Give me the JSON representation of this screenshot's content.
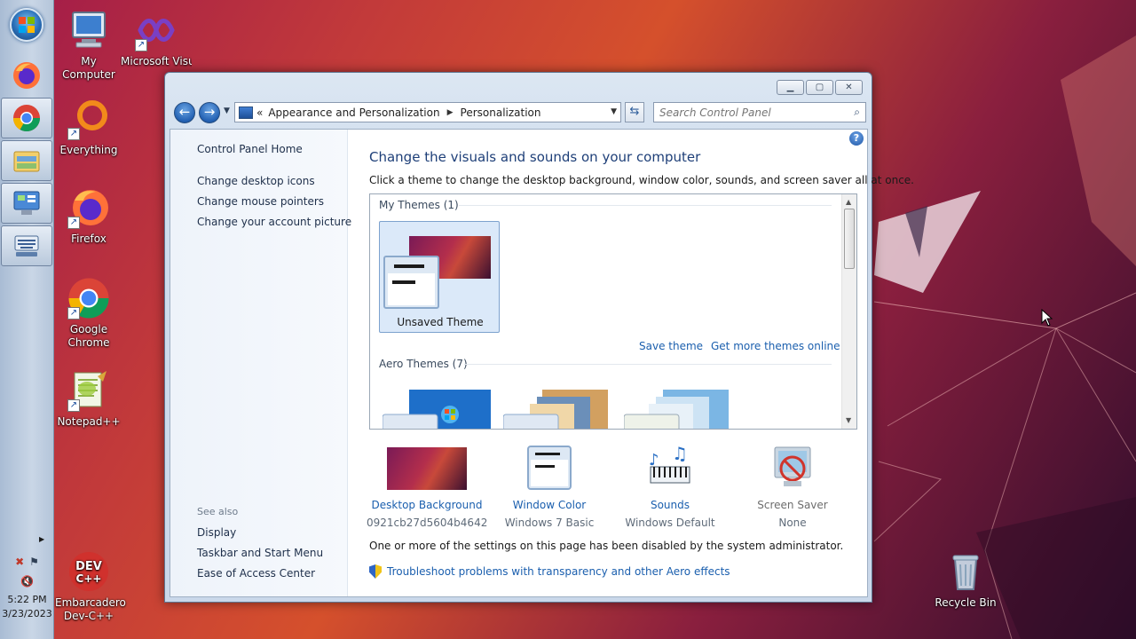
{
  "taskbar": {
    "clock_time": "5:22 PM",
    "clock_date": "3/23/2023"
  },
  "desktop_icons": [
    {
      "label": "My Computer"
    },
    {
      "label": "Microsoft Visual Stud..."
    },
    {
      "label": "Everything"
    },
    {
      "label": "Firefox"
    },
    {
      "label": "Google Chrome"
    },
    {
      "label": "Notepad++"
    },
    {
      "label": "Embarcadero Dev-C++"
    },
    {
      "label": "Recycle Bin"
    }
  ],
  "window": {
    "breadcrumb": {
      "overflow": "«",
      "items": [
        "Appearance and Personalization",
        "Personalization"
      ]
    },
    "search": {
      "placeholder": "Search Control Panel"
    },
    "left_pane": {
      "home": "Control Panel Home",
      "links": [
        "Change desktop icons",
        "Change mouse pointers",
        "Change your account picture"
      ],
      "see_also_title": "See also",
      "see_also": [
        "Display",
        "Taskbar and Start Menu",
        "Ease of Access Center"
      ]
    },
    "main": {
      "title": "Change the visuals and sounds on your computer",
      "subtitle": "Click a theme to change the desktop background, window color, sounds, and screen saver all at once.",
      "my_themes_header": "My Themes (1)",
      "unsaved_theme": "Unsaved Theme",
      "save_theme": "Save theme",
      "get_more": "Get more themes online",
      "aero_themes_header": "Aero Themes (7)",
      "bottom": [
        {
          "link": "Desktop Background",
          "value": "0921cb27d5604b464218..."
        },
        {
          "link": "Window Color",
          "value": "Windows 7 Basic"
        },
        {
          "link": "Sounds",
          "value": "Windows Default"
        },
        {
          "link": "Screen Saver",
          "value": "None"
        }
      ],
      "disabled_note": "One or more of the settings on this page has been disabled by the system administrator.",
      "troubleshoot": "Troubleshoot problems with transparency and other Aero effects"
    }
  },
  "colors": {
    "link": "#1b5fae",
    "title": "#1e3f78",
    "accent_wallpaper": "#c23a3a"
  },
  "icons": [
    "start-orb-icon",
    "firefox-icon",
    "chrome-icon",
    "explorer-icon",
    "control-panel-icon",
    "keyboard-icon",
    "search-icon",
    "help-icon",
    "shield-icon",
    "recycle-bin-icon"
  ]
}
